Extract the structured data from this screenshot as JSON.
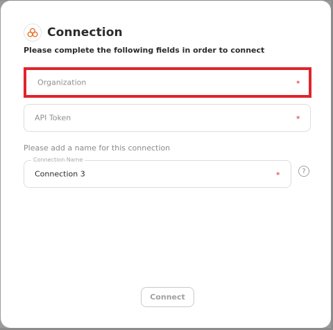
{
  "dialog": {
    "title": "Connection",
    "subtitle": "Please complete the following fields in order to connect",
    "logo_icon": "cloud-cluster-icon",
    "accent_color": "#e8742a"
  },
  "fields": {
    "organization": {
      "placeholder": "Organization",
      "value": "",
      "required_mark": "*",
      "highlighted": true
    },
    "api_token": {
      "placeholder": "API Token",
      "value": "",
      "required_mark": "*"
    },
    "connection_name": {
      "hint": "Please add a name for this connection",
      "legend": "Connection Name",
      "value": "Connection 3",
      "required_mark": "*",
      "help_label": "?"
    }
  },
  "actions": {
    "connect_label": "Connect"
  },
  "colors": {
    "highlight": "#e0242c",
    "required": "#e02020"
  }
}
